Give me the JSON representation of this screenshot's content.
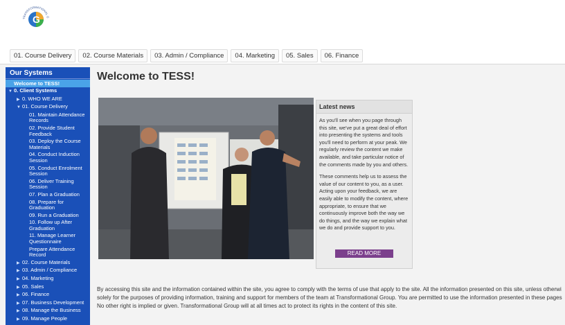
{
  "logo": {
    "name": "TRANSFORMATIONAL GROUP",
    "letter": "G"
  },
  "tabs": [
    "01. Course Delivery",
    "02. Course Materials",
    "03. Admin / Compliance",
    "04. Marketing",
    "05. Sales",
    "06. Finance"
  ],
  "sidebar": {
    "title": "Our Systems",
    "active": "Welcome to TESS!",
    "items": [
      {
        "level": 0,
        "label": "0. Client Systems",
        "expanded": true
      },
      {
        "level": 1,
        "label": "0. WHO WE ARE"
      },
      {
        "level": 1,
        "label": "01. Course Delivery",
        "expanded": true
      },
      {
        "level": 2,
        "label": "01. Maintain Attendance Records"
      },
      {
        "level": 2,
        "label": "02. Provide Student Feedback"
      },
      {
        "level": 2,
        "label": "03. Deploy the Course Materials"
      },
      {
        "level": 2,
        "label": "04. Conduct Induction Session"
      },
      {
        "level": 2,
        "label": "05. Conduct Enrolment Session"
      },
      {
        "level": 2,
        "label": "06. Deliver Training Session"
      },
      {
        "level": 2,
        "label": "07. Plan a Graduation"
      },
      {
        "level": 2,
        "label": "08. Prepare for Graduation"
      },
      {
        "level": 2,
        "label": "09. Run a Graduation"
      },
      {
        "level": 2,
        "label": "10. Follow up After Graduation"
      },
      {
        "level": 2,
        "label": "11. Manage Learner Questionnaire"
      },
      {
        "level": 2,
        "label": "Prepare Attendance Record"
      },
      {
        "level": 1,
        "label": "02. Course Materials"
      },
      {
        "level": 1,
        "label": "03. Admin / Compliance"
      },
      {
        "level": 1,
        "label": "04. Marketing"
      },
      {
        "level": 1,
        "label": "05. Sales"
      },
      {
        "level": 1,
        "label": "06. Finance"
      },
      {
        "level": 1,
        "label": "07. Business Development"
      },
      {
        "level": 1,
        "label": "08. Manage the Business"
      },
      {
        "level": 1,
        "label": "09. Manage People"
      }
    ]
  },
  "main": {
    "title": "Welcome to TESS!",
    "news": {
      "heading": "Latest news",
      "para1": "As you'll see when you page through this site, we've put a great deal of effort into presenting the systems and tools you'll need to perform at your peak. We regularly review the content we make available, and take particular notice of the comments made by you and others.",
      "para2": "These comments help us to assess the value of our content to you, as a user. Acting upon your feedback, we are easily able to modify the content, where appropriate, to ensure that we continuously improve both the way we do things, and the way we explain what we do and provide support to you.",
      "button": "READ MORE"
    },
    "footer": {
      "line1": "By accessing this site and the information contained within the site, you agree to comply with the terms of use that apply to the site. All the information presented on this site, unless otherwi",
      "line2": "solely for the purposes of providing information, training and support for members of the team at Transformational Group. You are permitted to use the information presented in these pages",
      "line3": "No other right is implied or given. Transformational Group will at all times act to protect its rights in the content of this site."
    }
  },
  "colors": {
    "sidebar": "#1a50b8",
    "active": "#4aa3e8",
    "button": "#7b3f8c"
  }
}
